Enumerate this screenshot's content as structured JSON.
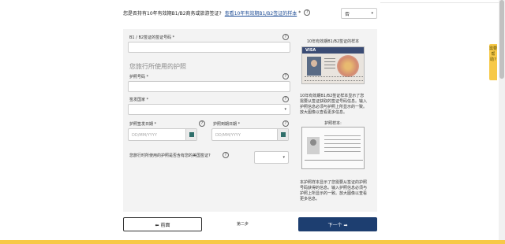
{
  "top_question": {
    "text": "您是否持有10年有效期B1/B2商务或旅游签证?",
    "link": "查看10年有效期B1/B2签证的样本",
    "required_mark": "*",
    "select_value": "否"
  },
  "form": {
    "visa_number_label": "B1 / B2签证的签证号码 *",
    "section_title": "您旅行所使用的护照",
    "passport_number_label": "护照号码 *",
    "issuing_country_label": "签发国家 *",
    "issue_date_label": "护照签发日期 *",
    "expiry_date_label": "护照到期日期 *",
    "date_placeholder": "DD/MM/YYYY",
    "us_visa_question": "您旅行时所使用的护照是否含有您的美国签证?"
  },
  "sidebar": {
    "visa_sample_title": "10年有效期B1/B2签证的样本",
    "visa_caption": "10年有效期B1/B2签证样本显示了您需要从签证获取的签证号码信息。输入护照信息必须与护照上所显示的一致。放大图像以查看更多信息。",
    "passport_sample_title": "护照样本:",
    "passport_caption": "本护照样本显示了您需要从签证的护照号码获得的信息。输入护照信息必须与护照上所显示的一致。放大图像以查看更多信息。"
  },
  "nav": {
    "prev_label": "⬅ 前面",
    "step_label": "第二步",
    "next_label": "下一个 ➡"
  },
  "help_tab": {
    "label": "需要帮助?"
  },
  "colors": {
    "primary": "#1d3e70",
    "link": "#1f4e96",
    "accent_yellow": "#f7c948",
    "panel": "#f3f3f3"
  }
}
